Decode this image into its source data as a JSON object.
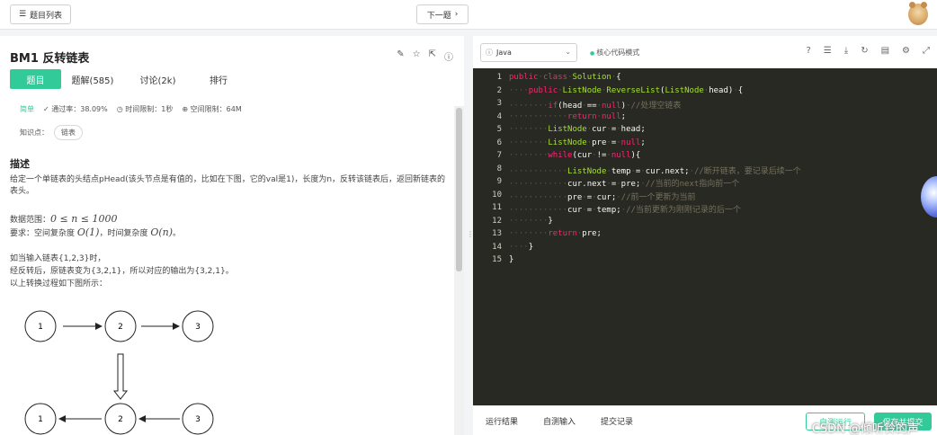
{
  "topbar": {
    "problem_list_label": "题目列表",
    "next_label": "下一题"
  },
  "problem": {
    "title": "BM1  反转链表",
    "tabs": [
      "题目",
      "题解(585)",
      "讨论(2k)",
      "排行"
    ],
    "difficulty": "简单",
    "pass_rate": "通过率：38.09%",
    "time_limit": "时间限制：1秒",
    "memory_limit": "空间限制：64M",
    "knowledge_label": "知识点：",
    "knowledge_tag": "链表",
    "desc_heading": "描述",
    "desc_text": "给定一个单链表的头结点pHead(该头节点是有值的，比如在下图，它的val是1)，长度为n，反转该链表后，返回新链表的表头。",
    "range_label": "数据范围：",
    "range_math": "0 ≤ n ≤ 1000",
    "req_label": "要求：空间复杂度 ",
    "req_space": "O(1)",
    "req_mid": "，时间复杂度 ",
    "req_time": "O(n)",
    "req_end": "。",
    "example_1": "如当输入链表{1,2,3}时，",
    "example_2": "经反转后，原链表变为{3,2,1}，所以对应的输出为{3,2,1}。",
    "example_3": "以上转换过程如下图所示：",
    "diagram_nodes": [
      "1",
      "2",
      "3"
    ]
  },
  "editor": {
    "language": "Java",
    "mode_label": "核心代码模式",
    "code_lines": [
      "public class Solution {",
      "    public ListNode ReverseList(ListNode head) {",
      "        if(head == null) //处理空链表",
      "            return null;",
      "        ListNode cur = head;",
      "        ListNode pre = null;",
      "        while(cur != null){",
      "            ListNode temp = cur.next; //断开链表，要记录后续一个",
      "            cur.next = pre; //当前的next指向前一个",
      "            pre = cur; //前一个更新为当前",
      "            cur = temp; //当前更新为刚刚记录的后一个",
      "        }",
      "        return pre;",
      "    }",
      "}"
    ],
    "line_numbers": [
      "1",
      "2",
      "3",
      "4",
      "5",
      "6",
      "7",
      "8",
      "9",
      "10",
      "11",
      "12",
      "13",
      "14",
      "15"
    ]
  },
  "bottom": {
    "tab_result": "运行结果",
    "tab_custom": "自测输入",
    "tab_history": "提交记录",
    "run_label": "自测运行",
    "submit_label": "保存并提交",
    "watermark": "CSDN @倾听铃的声"
  }
}
